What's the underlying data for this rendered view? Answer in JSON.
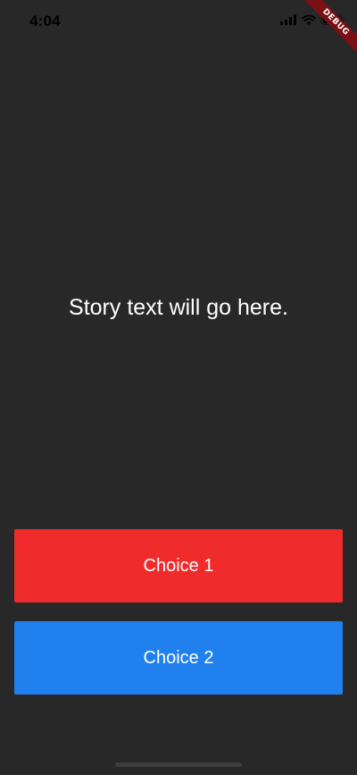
{
  "status_bar": {
    "time": "4:04",
    "icons": [
      "signal-icon",
      "wifi-icon",
      "battery-icon"
    ]
  },
  "debug_banner": {
    "label": "DEBUG"
  },
  "story": {
    "text": "Story text will go here."
  },
  "choices": [
    {
      "label": "Choice 1",
      "color": "#ef2b2b"
    },
    {
      "label": "Choice 2",
      "color": "#1f80ee"
    }
  ],
  "colors": {
    "background": "#282828",
    "text": "#ffffff",
    "debug_ribbon": "#7a1016"
  }
}
